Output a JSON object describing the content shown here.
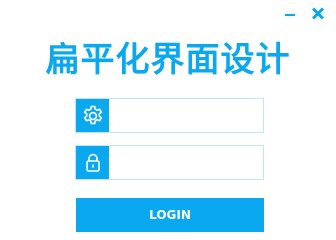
{
  "window": {
    "minimize_icon": "minimize-icon",
    "close_icon": "close-icon"
  },
  "title": "扁平化界面设计",
  "username": {
    "icon": "gear-icon",
    "value": "",
    "placeholder": ""
  },
  "password": {
    "icon": "lock-icon",
    "value": "",
    "placeholder": ""
  },
  "login_button": {
    "label": "LOGIN"
  },
  "colors": {
    "accent": "#0aa8ee",
    "field_border": "#bfe6f8",
    "background": "#ffffff"
  }
}
